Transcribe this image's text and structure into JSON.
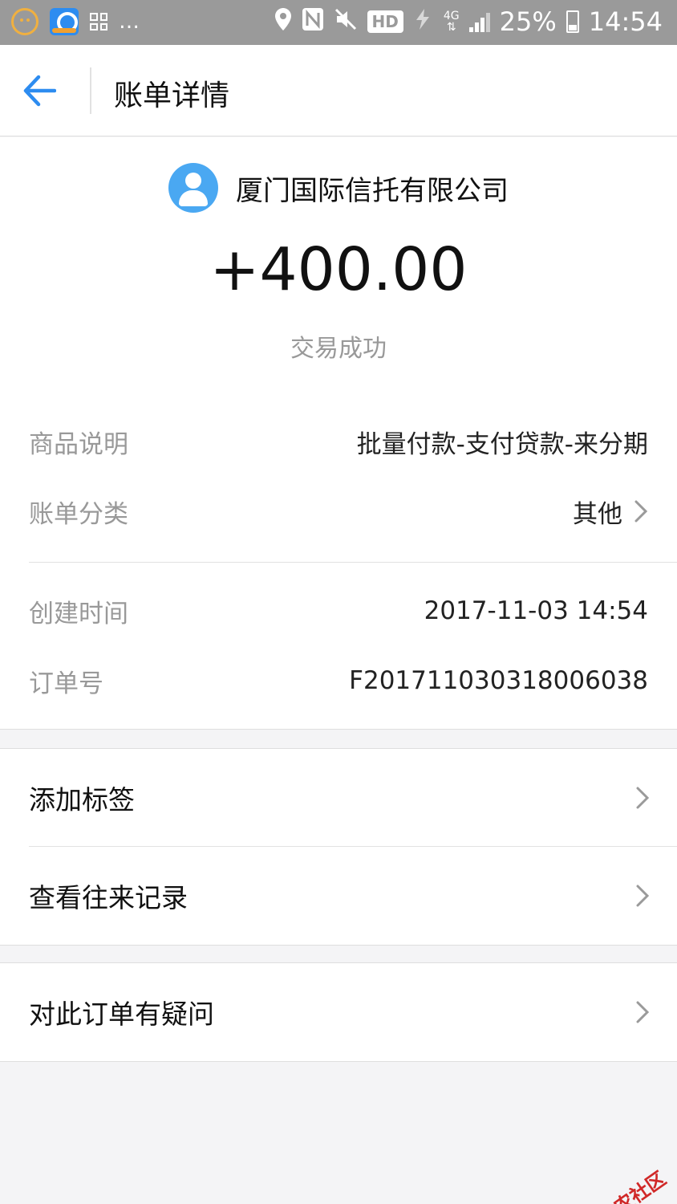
{
  "status_bar": {
    "battery": "25%",
    "time": "14:54",
    "network": "4G",
    "hd": "HD",
    "left_icons": [
      "emoji-icon",
      "app-notification-icon",
      "grid-icon",
      "more-icon"
    ],
    "right_icons": [
      "location-icon",
      "nfc-icon",
      "mute-icon",
      "hd-icon",
      "data-icon",
      "network-4g-icon",
      "signal-icon",
      "battery-icon"
    ]
  },
  "header": {
    "title": "账单详情",
    "back_icon": "back-arrow-icon"
  },
  "summary": {
    "merchant_name": "厦门国际信托有限公司",
    "amount": "+400.00",
    "status": "交易成功"
  },
  "details": {
    "rows": [
      {
        "label": "商品说明",
        "value": "批量付款-支付贷款-来分期"
      },
      {
        "label": "账单分类",
        "value": "其他"
      },
      {
        "label": "创建时间",
        "value": "2017-11-03 14:54"
      },
      {
        "label": "订单号",
        "value": "F201711030318006038"
      }
    ]
  },
  "actions": {
    "add_tag": "添加标签",
    "view_history": "查看往来记录",
    "question": "对此订单有疑问"
  },
  "watermark": {
    "text": "卡农社区"
  },
  "colors": {
    "accent": "#2d8cf0",
    "avatar": "#4aa8f2",
    "status_bar": "#9a9a9a",
    "label_gray": "#999999",
    "background": "#f4f4f6",
    "watermark_red": "#e03030"
  }
}
